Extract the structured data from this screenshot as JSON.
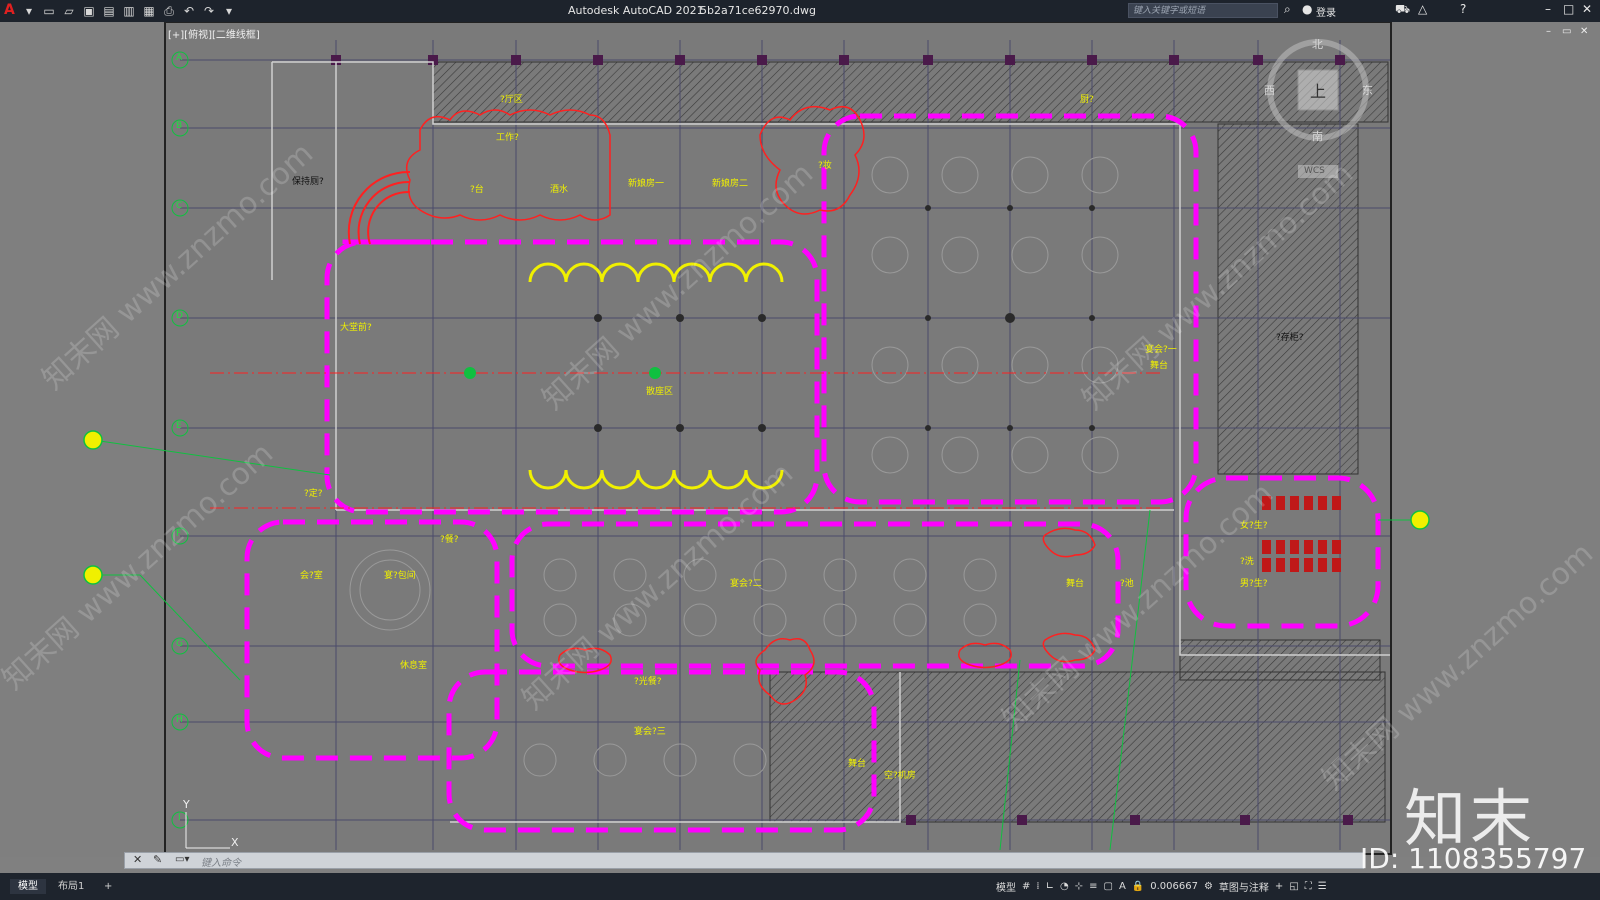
{
  "app": {
    "title": "Autodesk AutoCAD 2021",
    "filename": "5b2a71ce62970.dwg",
    "search_placeholder": "键入关键字或短语",
    "login": "登录"
  },
  "viewport": {
    "label": "[+][俯视][二维线框]"
  },
  "compass": {
    "north": "北",
    "south": "南",
    "east": "东",
    "west": "西",
    "top": "上",
    "ucs": "WCS"
  },
  "grid_axes": [
    "A",
    "B",
    "C",
    "D",
    "E",
    "F",
    "G",
    "H",
    "I"
  ],
  "rooms": {
    "r1": "保持厕?",
    "r2": "工作?",
    "r3": "?台",
    "r4": "酒水",
    "r5": "新娘房一",
    "r6": "新娘房二",
    "r7": "?妆",
    "r8": "大堂前?",
    "r9": "散座区",
    "r10": "宴会?一",
    "r11": "舞台",
    "r12": "?定?",
    "r13": "宴会?二",
    "r14": "舞台",
    "r15": "?池",
    "r16": "?餐?",
    "r17": "会?室",
    "r18": "宴?包间",
    "r19": "休息室",
    "r20": "?光餐?",
    "r21": "宴会?三",
    "r22": "舞台",
    "r23": "空?机房",
    "r24": "女?生?",
    "r25": "?洗",
    "r26": "男?生?",
    "r27": "?存柜?",
    "r28": "?厅区",
    "r29": "厨?"
  },
  "command_line": {
    "placeholder": "键入命令"
  },
  "layout_tabs": [
    "模型",
    "布局1"
  ],
  "status": {
    "model": "模型",
    "scale": "0.006667",
    "workspace": "草图与注释"
  },
  "watermark": {
    "brand": "知末",
    "id": "ID: 1108355797",
    "diag": "知末网 www.znzmo.com"
  },
  "colors": {
    "magenta": "#ff00ff",
    "yellow": "#f0f000",
    "red": "#ff2020",
    "green": "#00ff40",
    "cyan": "#40d0ff"
  }
}
